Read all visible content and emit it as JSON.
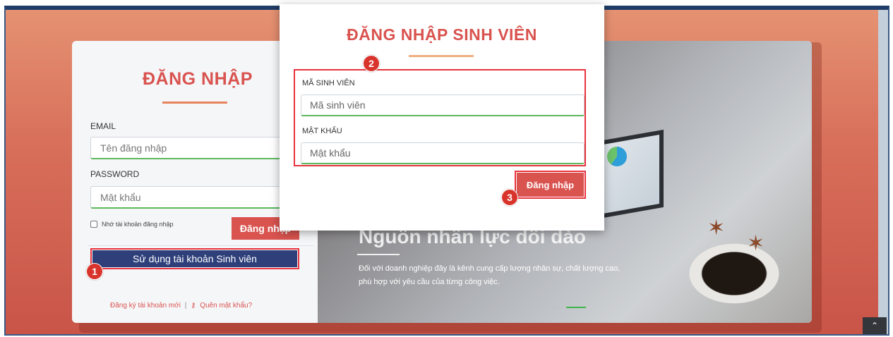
{
  "colors": {
    "accent_red": "#d9534f",
    "highlight_red": "#e8333e",
    "student_button": "#2e3f7a",
    "input_focus_green": "#5cb85c"
  },
  "left_login": {
    "title": "ĐĂNG NHẬP",
    "email_label": "EMAIL",
    "email_placeholder": "Tên đăng nhập",
    "password_label": "PASSWORD",
    "password_placeholder": "Mật khẩu",
    "remember_label": "Nhớ tài khoản đăng nhập",
    "login_button": "Đăng nhập",
    "student_button": "Sử dụng tài khoản Sinh viên",
    "register_link": "Đăng ký tài khoản mới",
    "separator": "|",
    "forgot_icon": "key-icon",
    "forgot_link": "Quên mật khẩu?"
  },
  "slide": {
    "heading": "Nguồn nhân lực dồi dào",
    "text": "Đối với doanh nghiệp đây là kênh cung cấp lượng nhân sự, chất lượng cao, phù hợp với yêu cầu của từng công việc."
  },
  "modal": {
    "title": "ĐĂNG NHẬP SINH VIÊN",
    "student_id_label": "MÃ SINH VIÊN",
    "student_id_placeholder": "Mã sinh viên",
    "password_label": "MẬT KHẨU",
    "password_placeholder": "Mật khẩu",
    "login_button": "Đăng nhập"
  },
  "steps": {
    "one": "1",
    "two": "2",
    "three": "3"
  },
  "scroll_top_icon": "chevron-up-icon"
}
